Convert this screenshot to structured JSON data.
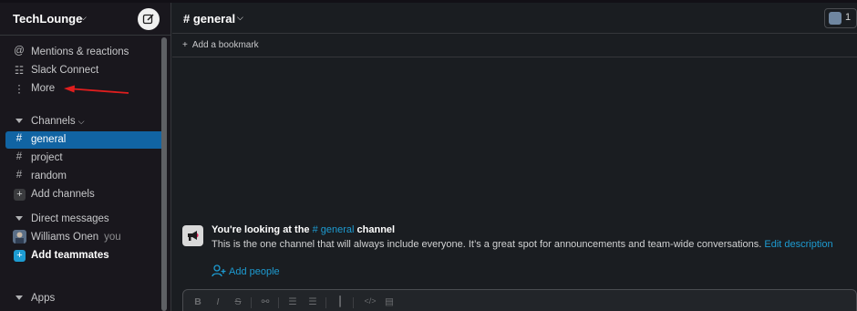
{
  "workspace": {
    "name": "TechLounge",
    "chevron_icon": "chevron-down-icon"
  },
  "sidebar": {
    "top_items": [
      {
        "label": "Mentions & reactions",
        "icon": "at-icon",
        "glyph": "@"
      },
      {
        "label": "Slack Connect",
        "icon": "building-icon",
        "glyph": "☷"
      },
      {
        "label": "More",
        "icon": "more-vertical-icon",
        "glyph": "⋮"
      }
    ],
    "channels_header": "Channels",
    "channels": [
      {
        "label": "general",
        "active": true
      },
      {
        "label": "project",
        "active": false
      },
      {
        "label": "random",
        "active": false
      }
    ],
    "add_channels": "Add channels",
    "dm_header": "Direct messages",
    "dm_user": {
      "name": "Williams Onen",
      "suffix": "you"
    },
    "add_teammates": "Add teammates",
    "apps_header": "Apps"
  },
  "channel_header": {
    "title": "# general",
    "member_count": "1"
  },
  "bookmark_bar": {
    "add_label": "Add a bookmark"
  },
  "intro": {
    "prefix": "You're looking at the",
    "channel_link": "# general",
    "suffix": "channel",
    "body": "This is the one channel that will always include everyone. It’s a great spot for announcements and team-wide conversations.",
    "edit_link": "Edit description",
    "add_people": "Add people"
  },
  "composer": {
    "tools": [
      {
        "glyph": "B",
        "icon": "bold-icon"
      },
      {
        "glyph": "I",
        "icon": "italic-icon"
      },
      {
        "glyph": "S",
        "icon": "strikethrough-icon"
      },
      {
        "glyph": "⚯",
        "icon": "link-icon"
      },
      {
        "glyph": "☰",
        "icon": "ordered-list-icon"
      },
      {
        "glyph": "☰",
        "icon": "bulleted-list-icon"
      },
      {
        "glyph": "┃",
        "icon": "blockquote-icon"
      },
      {
        "glyph": "</>",
        "icon": "code-icon"
      },
      {
        "glyph": "▤",
        "icon": "code-block-icon"
      }
    ]
  },
  "colors": {
    "sidebar_bg": "#19171d",
    "active_item": "#1164a3",
    "link": "#1d9bd1",
    "annotation_arrow": "#e01e1e"
  }
}
